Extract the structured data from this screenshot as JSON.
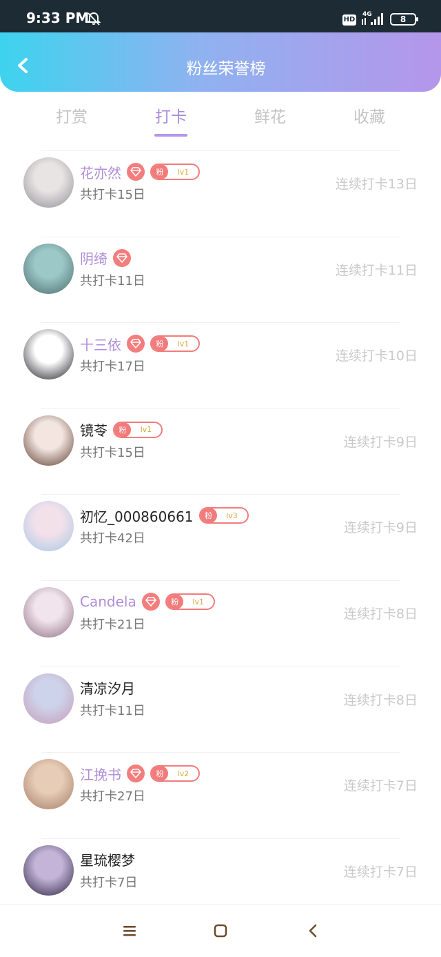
{
  "status_bar": {
    "time": "9:33 PM",
    "hd": "HD",
    "network": "4G",
    "battery": "8"
  },
  "header": {
    "title": "粉丝荣誉榜"
  },
  "tabs": [
    {
      "label": "打赏",
      "active": false
    },
    {
      "label": "打卡",
      "active": true
    },
    {
      "label": "鲜花",
      "active": false
    },
    {
      "label": "收藏",
      "active": false
    }
  ],
  "rows": [
    {
      "name": "花亦然",
      "vip": true,
      "diamond": true,
      "fan_badge": "粉",
      "fan_level": "lv1",
      "total": "共打卡15日",
      "streak": "连续打卡13日",
      "avatar_colors": [
        "#e9e4e4",
        "#8f8f96"
      ]
    },
    {
      "name": "阴绮",
      "vip": true,
      "diamond": true,
      "fan_badge": "",
      "fan_level": "",
      "total": "共打卡11日",
      "streak": "连续打卡11日",
      "avatar_colors": [
        "#9cc8c8",
        "#4c6a6a"
      ]
    },
    {
      "name": "十三依",
      "vip": true,
      "diamond": true,
      "fan_badge": "粉",
      "fan_level": "lv1",
      "total": "共打卡17日",
      "streak": "连续打卡10日",
      "avatar_colors": [
        "#ffffff",
        "#1b1b22"
      ]
    },
    {
      "name": "镜苓",
      "vip": false,
      "diamond": false,
      "fan_badge": "粉",
      "fan_level": "lv1",
      "total": "共打卡15日",
      "streak": "连续打卡9日",
      "avatar_colors": [
        "#f3e6e1",
        "#5a3a2c"
      ]
    },
    {
      "name": "初忆_000860661",
      "vip": false,
      "diamond": false,
      "fan_badge": "粉",
      "fan_level": "lv3",
      "total": "共打卡42日",
      "streak": "连续打卡9日",
      "avatar_colors": [
        "#f3e1ea",
        "#a7c8e6"
      ]
    },
    {
      "name": "Candela",
      "vip": true,
      "diamond": true,
      "fan_badge": "粉",
      "fan_level": "lv1",
      "total": "共打卡21日",
      "streak": "连续打卡8日",
      "avatar_colors": [
        "#f1e4ea",
        "#8d6e86"
      ]
    },
    {
      "name": "清凉汐月",
      "vip": false,
      "diamond": false,
      "fan_badge": "",
      "fan_level": "",
      "total": "共打卡11日",
      "streak": "连续打卡8日",
      "avatar_colors": [
        "#cdd3ea",
        "#c79ab8"
      ]
    },
    {
      "name": "江挽书",
      "vip": true,
      "diamond": true,
      "fan_badge": "粉",
      "fan_level": "lv2",
      "total": "共打卡27日",
      "streak": "连续打卡7日",
      "avatar_colors": [
        "#e7cdb7",
        "#a57b64"
      ]
    },
    {
      "name": "星琉樱梦",
      "vip": false,
      "diamond": false,
      "fan_badge": "",
      "fan_level": "",
      "total": "共打卡7日",
      "streak": "连续打卡7日",
      "avatar_colors": [
        "#c3b4d8",
        "#2c2240"
      ]
    }
  ],
  "colors": {
    "accent": "#b596ea",
    "gradient_start": "#3dd3ef",
    "gradient_end": "#b596ea",
    "badge": "#f27b7b"
  },
  "icons": {
    "back": "chevron-left-icon",
    "diamond": "diamond-icon",
    "nav_menu": "menu-icon",
    "nav_home": "square-icon",
    "nav_back": "back-triangle-icon"
  }
}
